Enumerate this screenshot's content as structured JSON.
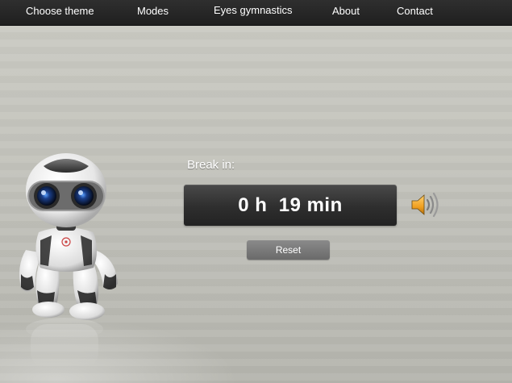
{
  "nav": {
    "items": [
      {
        "label": "Choose theme"
      },
      {
        "label": "Modes"
      },
      {
        "label": "Eyes gymnastics"
      },
      {
        "label": "About"
      },
      {
        "label": "Contact"
      }
    ]
  },
  "main": {
    "break_label": "Break in:",
    "timer": "0 h  19 min",
    "reset_label": "Reset",
    "sound_icon": "speaker-icon",
    "mascot_icon": "robot-icon"
  },
  "colors": {
    "navbar": "#262626",
    "background": "#c2c2bb",
    "timer_box": "#2e2e2e",
    "reset_button": "#7a7a7a",
    "speaker_accent": "#f0a020"
  }
}
